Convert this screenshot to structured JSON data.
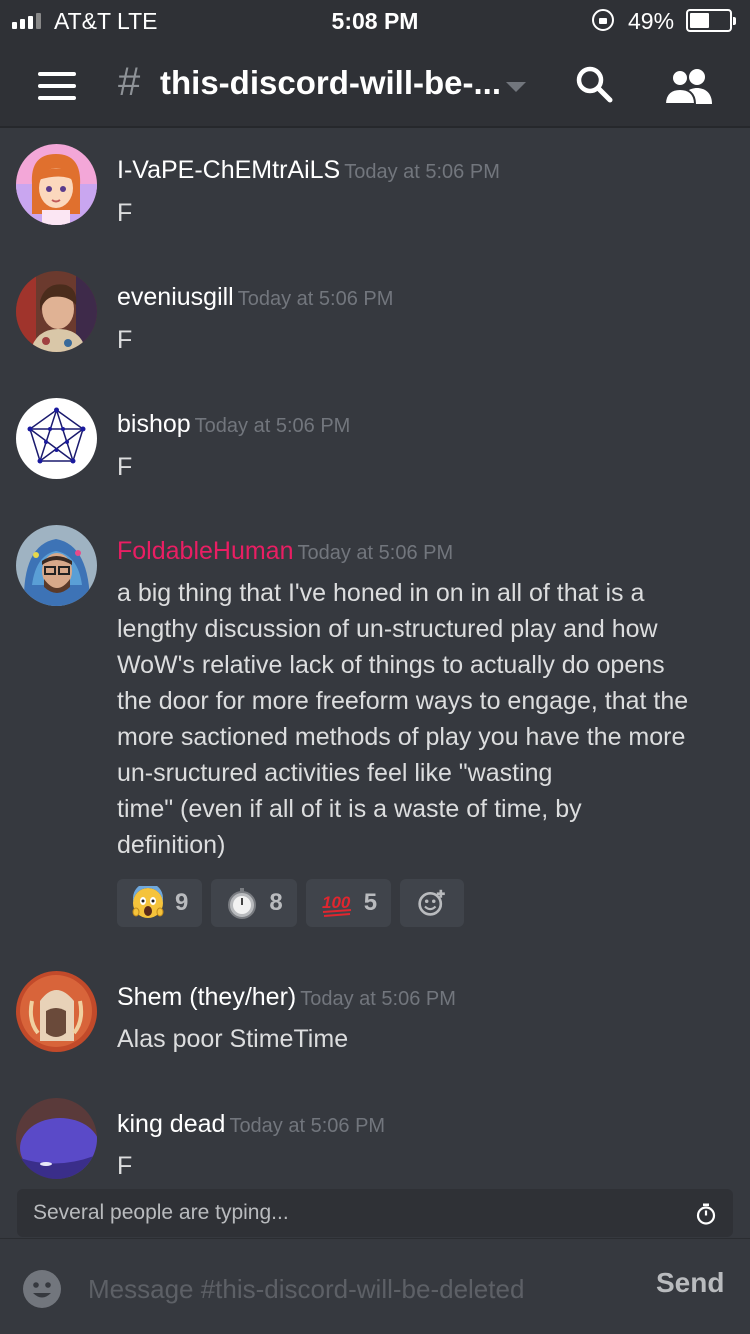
{
  "status_bar": {
    "carrier": "AT&T  LTE",
    "time": "5:08 PM",
    "battery": "49%"
  },
  "header": {
    "channel_name": "this-discord-will-be-..."
  },
  "messages": [
    {
      "author": "I-VaPE-ChEMtrAiLS",
      "timestamp": "Today at 5:06 PM",
      "text": "F",
      "author_color": "#ffffff"
    },
    {
      "author": "eveniusgill",
      "timestamp": "Today at 5:06 PM",
      "text": "F",
      "author_color": "#ffffff"
    },
    {
      "author": "bishop",
      "timestamp": "Today at 5:06 PM",
      "text": "F",
      "author_color": "#ffffff"
    },
    {
      "author": "FoldableHuman",
      "timestamp": "Today at 5:06 PM",
      "author_color": "#e91e63",
      "lines": [
        "a big thing that I've honed in on in all of that is a",
        "lengthy discussion of un-structured play and how",
        "WoW's relative lack of things to actually do opens",
        "the door for more freeform ways to engage, that the",
        "more sactioned methods of play you have the more",
        "un-sructured activities feel like \"wasting",
        "time\" (even if all of it is a waste of time, by",
        "definition)"
      ],
      "reactions": [
        {
          "emoji": "screaming-face",
          "count": "9"
        },
        {
          "emoji": "stopwatch",
          "count": "8"
        },
        {
          "emoji": "hundred-points",
          "count": "5"
        }
      ]
    },
    {
      "author": "Shem (they/her)",
      "timestamp": "Today at 5:06 PM",
      "text": "Alas poor StimeTime",
      "author_color": "#ffffff"
    },
    {
      "author": "king dead",
      "timestamp": "Today at 5:06 PM",
      "text": "F",
      "author_color": "#ffffff"
    }
  ],
  "typing_indicator": "Several people are typing...",
  "composer": {
    "placeholder": "Message #this-discord-will-be-deleted",
    "send_label": "Send"
  },
  "colors": {
    "background": "#36393f",
    "header": "#2f3136",
    "accent_author": "#e91e63",
    "timestamp": "#72767d"
  }
}
